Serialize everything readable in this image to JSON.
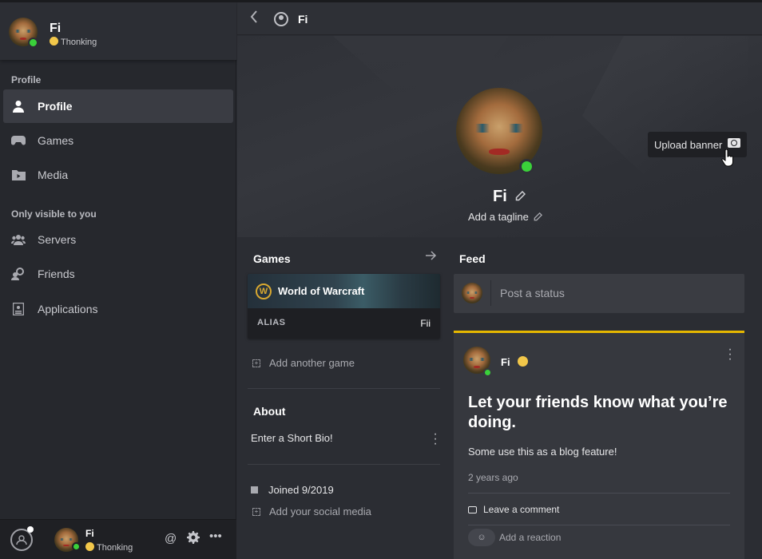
{
  "sidebar": {
    "user": {
      "name": "Fi",
      "status": "Thonking"
    },
    "sections": [
      {
        "label": "Profile"
      },
      {
        "label": "Only visible to you"
      }
    ],
    "items": [
      {
        "label": "Profile",
        "icon": "person-icon"
      },
      {
        "label": "Games",
        "icon": "gamepad-icon"
      },
      {
        "label": "Media",
        "icon": "media-icon"
      },
      {
        "label": "Servers",
        "icon": "servers-icon"
      },
      {
        "label": "Friends",
        "icon": "friends-icon"
      },
      {
        "label": "Applications",
        "icon": "applications-icon"
      }
    ],
    "bottom": {
      "name": "Fi",
      "status": "Thonking"
    }
  },
  "header": {
    "title": "Fi"
  },
  "profile": {
    "name": "Fi",
    "tagline_placeholder": "Add a tagline",
    "upload_banner": "Upload banner"
  },
  "games": {
    "heading": "Games",
    "card": {
      "title": "World of Warcraft",
      "alias_label": "ALIAS",
      "alias_value": "Fii"
    },
    "add_label": "Add another game"
  },
  "about": {
    "heading": "About",
    "bio_placeholder": "Enter a Short Bio!",
    "joined": "Joined 9/2019",
    "social": "Add your social media"
  },
  "feed": {
    "heading": "Feed",
    "post_placeholder": "Post a status",
    "card": {
      "author": "Fi",
      "headline": "Let your friends know what you’re doing.",
      "body": "Some use this as a blog feature!",
      "time": "2 years ago",
      "comment": "Leave a comment",
      "reaction": "Add a reaction"
    }
  },
  "colors": {
    "accent": "#e6b800",
    "online": "#3ad13a"
  }
}
